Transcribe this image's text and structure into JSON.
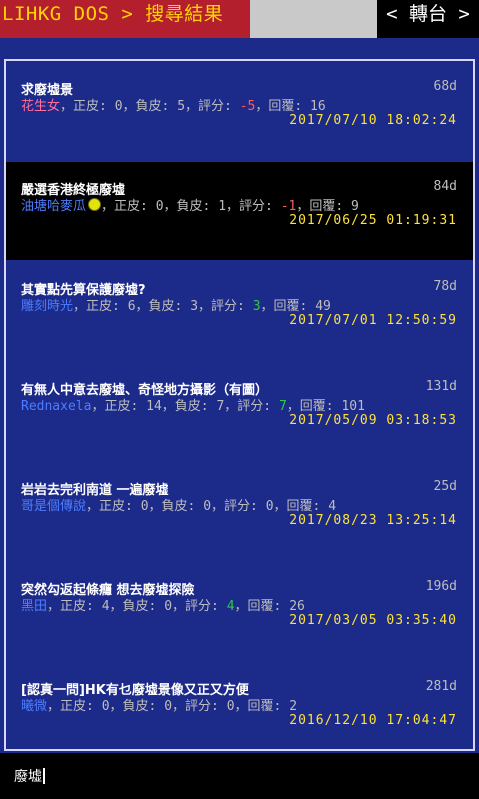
{
  "header": {
    "title": "LIHKG DOS > 搜尋結果",
    "nav": "< 轉台 >"
  },
  "labels": {
    "like": "正皮:",
    "dislike": "負皮:",
    "score": "評分:",
    "replies": "回覆:"
  },
  "results": [
    {
      "title": "求廢墟景",
      "user": "花生女",
      "user_gender": "female",
      "likes": "0",
      "dislikes": "5",
      "score": "-5",
      "replies": "16",
      "age": "68d",
      "time": "2017/07/10  18:02:24"
    },
    {
      "title": "嚴選香港終極廢墟",
      "user": "油塘哈麥瓜",
      "user_icon": "smiley-icon",
      "likes": "0",
      "dislikes": "1",
      "score": "-1",
      "replies": "9",
      "age": "84d",
      "time": "2017/06/25  01:19:31"
    },
    {
      "title": "其實點先算保護廢墟?",
      "user": "雕刻時光",
      "likes": "6",
      "dislikes": "3",
      "score": "3",
      "replies": "49",
      "age": "78d",
      "time": "2017/07/01  12:50:59"
    },
    {
      "title": "有無人中意去廢墟、奇怪地方攝影（有圖）",
      "user": "Rednaxela",
      "likes": "14",
      "dislikes": "7",
      "score": "7",
      "replies": "101",
      "age": "131d",
      "time": "2017/05/09  03:18:53"
    },
    {
      "title": "岩岩去完利南道 一遍廢墟",
      "user": "哥是個傳說",
      "likes": "0",
      "dislikes": "0",
      "score": "0",
      "replies": "4",
      "age": "25d",
      "time": "2017/08/23  13:25:14"
    },
    {
      "title": "突然勾返起條癮 想去廢墟探險",
      "user": "黑田",
      "likes": "4",
      "dislikes": "0",
      "score": "4",
      "replies": "26",
      "age": "196d",
      "time": "2017/03/05  03:35:40"
    },
    {
      "title": "[認真一問]HK有乜廢墟景像又正又方便",
      "user": "曦微",
      "likes": "0",
      "dislikes": "0",
      "score": "0",
      "replies": "2",
      "age": "281d",
      "time": "2016/12/10  17:04:47"
    }
  ],
  "search": {
    "query": "廢墟"
  },
  "colors": {
    "background": "#1c2a8a",
    "title_bar": "#b41f2e",
    "title_text": "#ffe23a",
    "timestamp": "#ffe23a",
    "negative_score": "#ff5b5b",
    "positive_score": "#2ec84a",
    "username": "#4d7dff",
    "female_username": "#ff6fa0"
  }
}
